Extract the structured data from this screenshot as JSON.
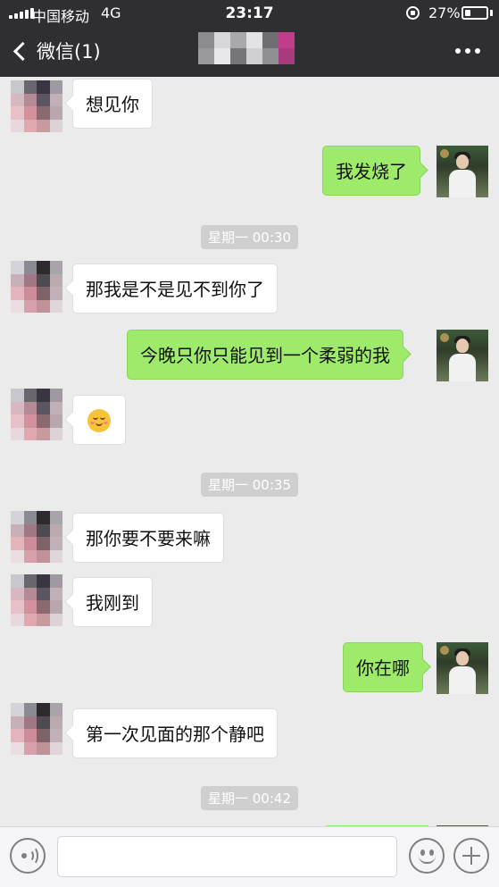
{
  "status_bar": {
    "carrier": "中国移动",
    "network": "4G",
    "time": "23:17",
    "battery_percent": "27%",
    "battery_level": 0.27,
    "icons": [
      "signal-icon",
      "orientation-lock-icon",
      "battery-icon"
    ]
  },
  "nav": {
    "back_label": "微信(1)",
    "contact_name_pixelated": true,
    "more_icon": "more-dots-icon"
  },
  "messages": [
    {
      "side": "left",
      "text": "想见你"
    },
    {
      "side": "right",
      "text": "我发烧了"
    },
    {
      "type": "time",
      "text": "星期一 00:30"
    },
    {
      "side": "left",
      "text": "那我是不是见不到你了"
    },
    {
      "side": "right",
      "text": "今晚只你只能见到一个柔弱的我"
    },
    {
      "side": "left",
      "emoji": "smiling-face-emoji"
    },
    {
      "type": "time",
      "text": "星期一 00:35"
    },
    {
      "side": "left",
      "text": "那你要不要来嘛"
    },
    {
      "side": "left",
      "text": "我刚到"
    },
    {
      "side": "right",
      "text": "你在哪"
    },
    {
      "side": "left",
      "text": "第一次见面的那个静吧"
    },
    {
      "type": "time",
      "text": "星期一 00:42"
    }
  ],
  "input_bar": {
    "voice_icon": "voice-icon",
    "input_value": "",
    "emoji_icon": "emoji-icon",
    "plus_icon": "plus-icon"
  },
  "colors": {
    "header_bg": "#2e2e33",
    "chat_bg": "#ebebeb",
    "outgoing_bubble": "#9eea6a",
    "incoming_bubble": "#ffffff",
    "timestamp_bg": "#cfcfcf"
  }
}
